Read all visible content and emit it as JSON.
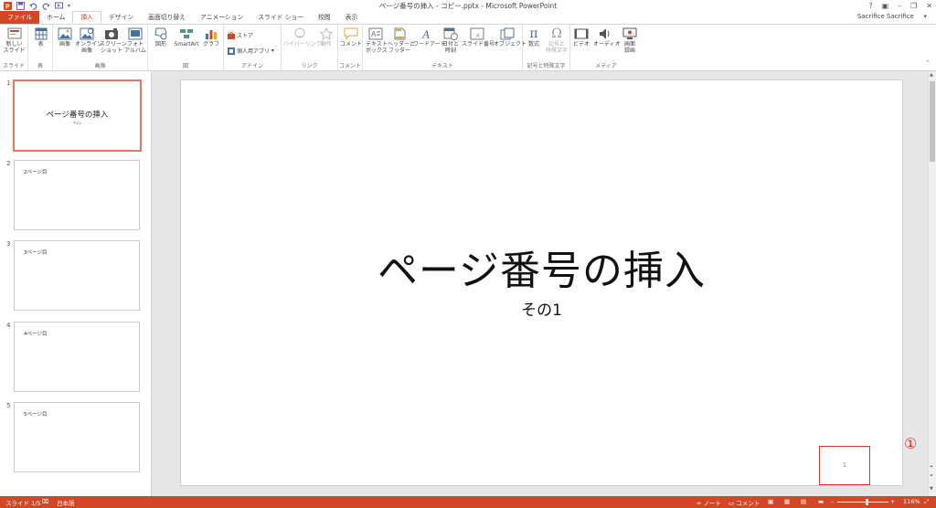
{
  "window": {
    "title": "ページ番号の挿入 - コピー.pptx - Microsoft PowerPoint",
    "controls": [
      "?",
      "▣",
      "–",
      "❐",
      "✕"
    ]
  },
  "tabs": [
    "ファイル",
    "ホーム",
    "挿入",
    "デザイン",
    "画面切り替え",
    "アニメーション",
    "スライド ショー",
    "校閲",
    "表示"
  ],
  "active_tab": "挿入",
  "user": {
    "name": "Sacrifice Sacrifice"
  },
  "ribbon": {
    "groups": {
      "slides": "スライド",
      "table": "表",
      "images": "画像",
      "illustrations": "図",
      "addins": "アドイン",
      "links": "リンク",
      "comments": "コメント",
      "text": "テキスト",
      "symbols": "記号と特殊文字",
      "media": "メディア"
    },
    "buttons": {
      "new_slide": [
        "新しい",
        "スライド"
      ],
      "table": [
        "表"
      ],
      "image": [
        "画像"
      ],
      "online_image": [
        "オンライン",
        "画像"
      ],
      "screenshot": [
        "スクリーン",
        "ショット"
      ],
      "photo_album": [
        "フォト",
        "アルバム"
      ],
      "shapes": [
        "図形"
      ],
      "smartart": [
        "SmartArt"
      ],
      "chart": [
        "グラフ"
      ],
      "store": "ストア",
      "my_apps": "個人用アプリ",
      "hyperlink": [
        "ハイパーリンク"
      ],
      "action": [
        "動作"
      ],
      "comment": [
        "コメント"
      ],
      "textbox": [
        "テキスト",
        "ボックス"
      ],
      "header_footer": [
        "ヘッダーと",
        "フッター"
      ],
      "wordart": [
        "ワードアート"
      ],
      "date_time": [
        "日付と",
        "時刻"
      ],
      "slide_number": [
        "スライド番号"
      ],
      "object": [
        "オブジェクト"
      ],
      "equation": [
        "数式"
      ],
      "symbol": [
        "記号と",
        "特殊文字"
      ],
      "video": [
        "ビデオ"
      ],
      "audio": [
        "オーディオ"
      ],
      "screen_recording": [
        "画面",
        "録画"
      ]
    }
  },
  "thumbnails": [
    {
      "num": "1",
      "title": "ページ番号の挿入",
      "sub": "その1"
    },
    {
      "num": "2",
      "head": "2ページ目"
    },
    {
      "num": "3",
      "head": "3ページ目"
    },
    {
      "num": "4",
      "head": "4ページ目"
    },
    {
      "num": "5",
      "head": "5ページ目"
    }
  ],
  "slide": {
    "title": "ページ番号の挿入",
    "subtitle": "その1",
    "page_number": "1",
    "callout": "①"
  },
  "status": {
    "slide": "スライド 1/5",
    "language": "日本語",
    "notes": "ノート",
    "comments": "コメント",
    "zoom": "116%",
    "zoom_fraction": 0.55
  },
  "colors": {
    "accent": "#d24726",
    "highlight": "#d9362b"
  }
}
